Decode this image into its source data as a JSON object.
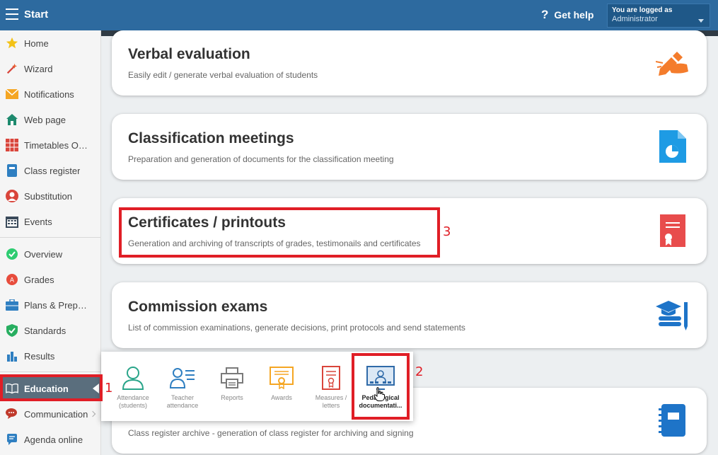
{
  "topbar": {
    "start_label": "Start",
    "help_label": "Get help",
    "user_line1": "You are logged as",
    "user_line2": "Administrator"
  },
  "sidebar": {
    "items": [
      {
        "label": "Home",
        "icon": "star-icon"
      },
      {
        "label": "Wizard",
        "icon": "magic-wand-icon"
      },
      {
        "label": "Notifications",
        "icon": "envelope-icon"
      },
      {
        "label": "Web page",
        "icon": "house-icon"
      },
      {
        "label": "Timetables Online",
        "icon": "timetable-grid-icon"
      },
      {
        "label": "Class register",
        "icon": "notebook-icon"
      },
      {
        "label": "Substitution",
        "icon": "person-icon"
      },
      {
        "label": "Events",
        "icon": "calendar-icon"
      },
      {
        "label": "Overview",
        "icon": "check-circle-icon"
      },
      {
        "label": "Grades",
        "icon": "grades-icon"
      },
      {
        "label": "Plans & Preparations",
        "icon": "briefcase-icon"
      },
      {
        "label": "Standards",
        "icon": "shield-check-icon"
      },
      {
        "label": "Results",
        "icon": "bar-chart-icon"
      },
      {
        "label": "Education",
        "icon": "open-book-icon"
      },
      {
        "label": "Communication",
        "icon": "chat-bubbles-icon"
      },
      {
        "label": "Agenda online",
        "icon": "agenda-icon"
      }
    ]
  },
  "cards": [
    {
      "title": "Verbal evaluation",
      "desc": "Easily edit / generate verbal evaluation of students",
      "icon": "hand-pen-icon"
    },
    {
      "title": "Classification meetings",
      "desc": "Preparation and generation of documents for the classification meeting",
      "icon": "document-chart-icon"
    },
    {
      "title": "Certificates / printouts",
      "desc": "Generation and archiving of transcripts of grades, testimonails and certificates",
      "icon": "certificate-icon"
    },
    {
      "title": "Commission exams",
      "desc": "List of commission examinations, generate decisions, print protocols and send statements",
      "icon": "graduation-books-icon"
    },
    {
      "title": "",
      "desc": "Class register archive - generation of class register for archiving and signing",
      "icon": "register-book-icon"
    }
  ],
  "popup": {
    "items": [
      {
        "label": "Attendance (students)",
        "icon": "student-icon"
      },
      {
        "label": "Teacher attendance",
        "icon": "teacher-list-icon"
      },
      {
        "label": "Reports",
        "icon": "printer-icon"
      },
      {
        "label": "Awards",
        "icon": "award-document-icon"
      },
      {
        "label": "Measures / letters",
        "icon": "measures-letter-icon"
      },
      {
        "label": "Pedagogical documentati...",
        "icon": "pedagogical-board-icon"
      }
    ]
  },
  "annotations": [
    "1",
    "2",
    "3"
  ],
  "colors": {
    "topbar": "#2d6a9f",
    "active_sidebar": "#5a6e7d",
    "annotation_red": "#e01e26"
  }
}
